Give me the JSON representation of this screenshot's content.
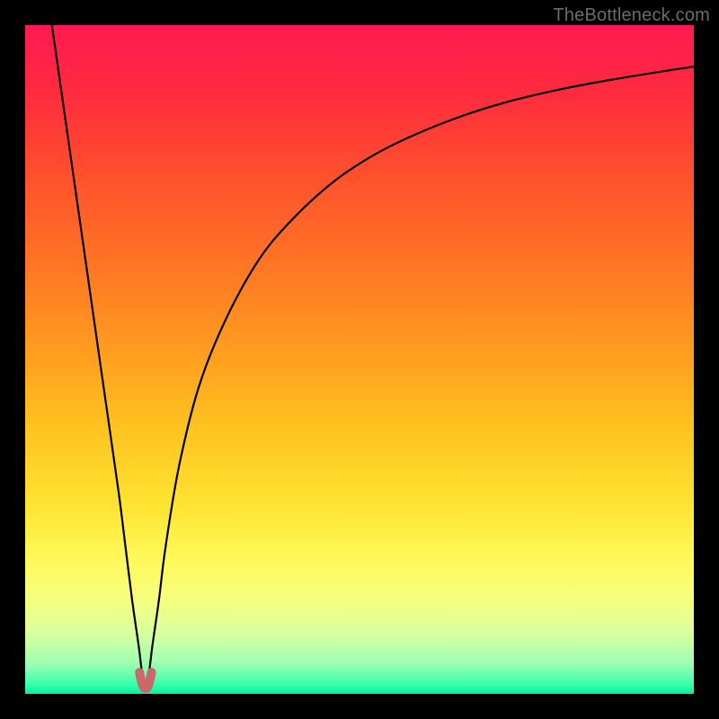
{
  "watermark": "TheBottleneck.com",
  "colors": {
    "frame": "#000000",
    "curve_stroke": "#000000",
    "highlight_stroke": "#c9696c",
    "gradient_stops": [
      {
        "offset": 0.0,
        "color": "#ff1a52"
      },
      {
        "offset": 0.1,
        "color": "#ff2b3e"
      },
      {
        "offset": 0.22,
        "color": "#ff4f2d"
      },
      {
        "offset": 0.35,
        "color": "#ff7325"
      },
      {
        "offset": 0.48,
        "color": "#ff9a1f"
      },
      {
        "offset": 0.6,
        "color": "#ffc21f"
      },
      {
        "offset": 0.72,
        "color": "#ffe432"
      },
      {
        "offset": 0.8,
        "color": "#fff95b"
      },
      {
        "offset": 0.86,
        "color": "#f6ff7e"
      },
      {
        "offset": 0.91,
        "color": "#d8ffa0"
      },
      {
        "offset": 0.955,
        "color": "#9cffb2"
      },
      {
        "offset": 0.985,
        "color": "#3dffac"
      },
      {
        "offset": 1.0,
        "color": "#00f59a"
      }
    ]
  },
  "chart_data": {
    "type": "line",
    "title": "",
    "xlabel": "",
    "ylabel": "",
    "x_range": [
      0,
      100
    ],
    "y_range": [
      0,
      100
    ],
    "x_optimum": 18,
    "series": [
      {
        "name": "bottleneck-curve",
        "x": [
          4,
          6,
          8,
          10,
          12,
          14,
          15,
          16,
          17,
          17.5,
          18,
          18.5,
          19,
          20,
          21,
          23,
          26,
          30,
          35,
          40,
          46,
          52,
          58,
          65,
          72,
          80,
          88,
          96,
          100
        ],
        "y": [
          100,
          86,
          72,
          58,
          44,
          30,
          22,
          14,
          7,
          3,
          1,
          3,
          7,
          14,
          22,
          34,
          46,
          56,
          65,
          71,
          76.5,
          80.5,
          83.5,
          86.3,
          88.5,
          90.4,
          91.9,
          93.2,
          93.8
        ]
      }
    ],
    "highlight": {
      "name": "optimal-region",
      "x": [
        17.1,
        17.4,
        17.7,
        18.0,
        18.3,
        18.6,
        18.9
      ],
      "y": [
        3.2,
        1.8,
        1.0,
        0.8,
        1.0,
        1.8,
        3.2
      ]
    }
  }
}
